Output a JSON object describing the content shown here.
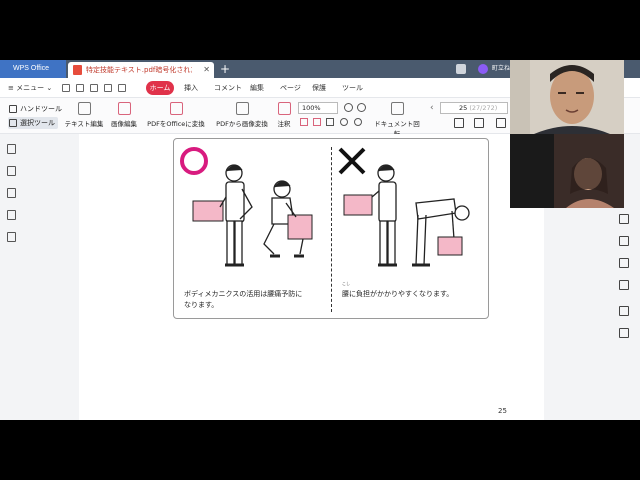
{
  "app": {
    "name": "WPS Office",
    "document_tab": "特定技能テキスト.pdf暗号化された",
    "new_tab": "+",
    "user_name": "町立ね"
  },
  "menu": {
    "menu_label": "メニュー",
    "tabs": [
      "ホーム",
      "挿入",
      "コメント",
      "編集",
      "ページ",
      "保護",
      "ツール"
    ],
    "active_tab": "ホーム"
  },
  "toolbar": {
    "hand_tool": "ハンドツール",
    "select_tool": "選択ツール",
    "text_edit": "テキスト編集",
    "image_edit": "画像編集",
    "pdf_to_office": "PDFをOfficeに変換",
    "pdf_to_image": "PDFから画像変換",
    "annotate": "注釈",
    "rotate": "ドキュメント回転",
    "zoom": "100%",
    "page_current": "25",
    "page_total": "(27/272)"
  },
  "document": {
    "good_caption_line1": "ボディメカニクスの活用は腰痛予防に",
    "good_caption_line2": "なります。",
    "bad_caption": "腰に負担がかかりやすくなります。",
    "bad_caption_ruby": "こし",
    "page_number": "25"
  },
  "colors": {
    "accent": "#e0324a",
    "circle_mark": "#d81b7f",
    "box_pink": "#f4b8c8",
    "app_tab_blue": "#3f73c4"
  },
  "icons": {
    "good_mark": "magenta-circle",
    "bad_mark": "black-cross"
  }
}
